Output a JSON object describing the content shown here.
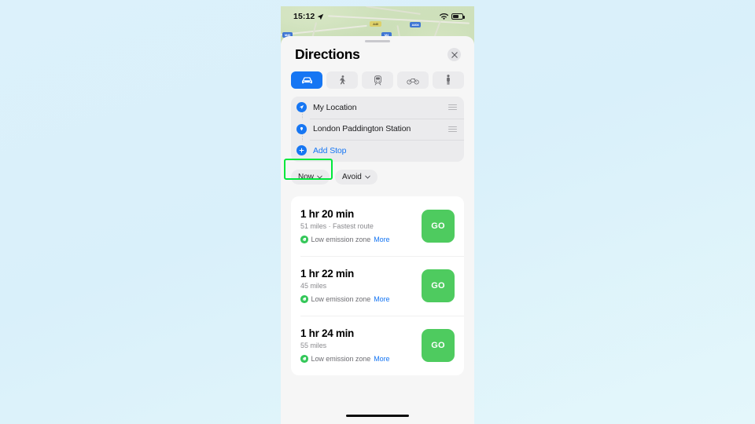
{
  "status_bar": {
    "time": "15:12",
    "location_arrow_icon": "location-arrow-icon",
    "wifi_icon": "wifi-icon",
    "battery_icon": "battery-icon"
  },
  "map": {
    "shields": [
      "M40",
      "A40",
      "A404",
      "M4"
    ]
  },
  "sheet": {
    "title": "Directions",
    "close_icon": "close-icon",
    "grabber": "sheet-grabber"
  },
  "modes": [
    {
      "name": "drive",
      "icon": "car-icon",
      "selected": true
    },
    {
      "name": "walk",
      "icon": "walk-icon",
      "selected": false
    },
    {
      "name": "transit",
      "icon": "transit-icon",
      "selected": false
    },
    {
      "name": "cycle",
      "icon": "bicycle-icon",
      "selected": false
    },
    {
      "name": "rideshare",
      "icon": "person-icon",
      "selected": false
    }
  ],
  "fields": [
    {
      "icon": "navigation-arrow-icon",
      "text": "My Location",
      "is_link": false
    },
    {
      "icon": "destination-pin-icon",
      "text": "London Paddington Station",
      "is_link": false
    },
    {
      "icon": "plus-icon",
      "text": "Add Stop",
      "is_link": true
    }
  ],
  "filters": {
    "departure": {
      "label": "Now",
      "chevron_icon": "chevron-down-icon",
      "highlighted": true
    },
    "avoid": {
      "label": "Avoid",
      "chevron_icon": "chevron-down-icon",
      "highlighted": false
    },
    "highlight_color": "#00e83c"
  },
  "routes": [
    {
      "duration": "1 hr 20 min",
      "detail": "51 miles · Fastest route",
      "zone_label": "Low emission zone",
      "more_label": "More",
      "go_label": "GO"
    },
    {
      "duration": "1 hr 22 min",
      "detail": "45 miles",
      "zone_label": "Low emission zone",
      "more_label": "More",
      "go_label": "GO"
    },
    {
      "duration": "1 hr 24 min",
      "detail": "55 miles",
      "zone_label": "Low emission zone",
      "more_label": "More",
      "go_label": "GO"
    }
  ],
  "colors": {
    "accent_blue": "#1676f3",
    "go_green": "#4ecb5f",
    "highlight_green": "#00e83c",
    "page_background": "#dcf1fb"
  }
}
